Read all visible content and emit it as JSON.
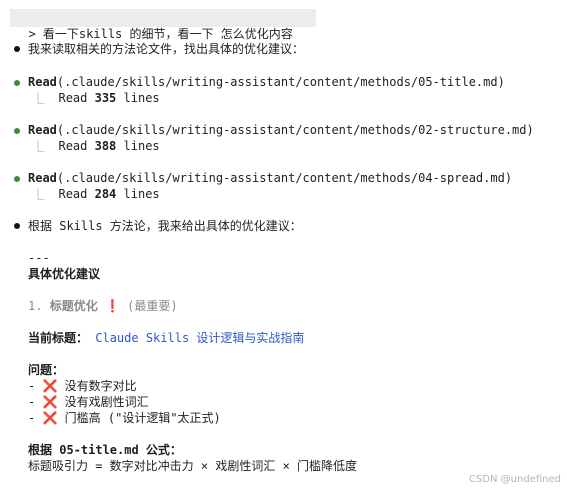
{
  "prompt": {
    "prefix": ">",
    "text": "看一下skills 的细节，看一下 怎么优化内容"
  },
  "messages": {
    "intro": "我来读取相关的方法论文件，找出具体的优化建议：",
    "conclusion": "根据 Skills 方法论，我来给出具体的优化建议："
  },
  "reads": [
    {
      "tool": "Read",
      "path": "(.claude/skills/writing-assistant/content/methods/05-title.md)",
      "result_prefix": "Read",
      "count": "335",
      "result_suffix": "lines"
    },
    {
      "tool": "Read",
      "path": "(.claude/skills/writing-assistant/content/methods/02-structure.md)",
      "result_prefix": "Read",
      "count": "388",
      "result_suffix": "lines"
    },
    {
      "tool": "Read",
      "path": "(.claude/skills/writing-assistant/content/methods/04-spread.md)",
      "result_prefix": "Read",
      "count": "284",
      "result_suffix": "lines"
    }
  ],
  "content": {
    "divider": "---",
    "heading": "具体优化建议",
    "section_number": "1.",
    "section_title": "标题优化",
    "section_icon": "❗",
    "section_note": "(最重要)",
    "current_title_label": "当前标题：",
    "current_title_value": "Claude Skills 设计逻辑与实战指南",
    "problems_label": "问题：",
    "problems": [
      {
        "dash": "-",
        "icon": "❌",
        "text": "没有数字对比"
      },
      {
        "dash": "-",
        "icon": "❌",
        "text": "没有戏剧性词汇"
      },
      {
        "dash": "-",
        "icon": "❌",
        "text": "门槛高 (\"设计逻辑\"太正式)"
      }
    ],
    "formula_label": "根据 05-title.md 公式：",
    "formula_text": "标题吸引力 = 数字对比冲击力 × 戏剧性词汇 × 门槛降低度"
  },
  "watermark": "CSDN @undefined"
}
